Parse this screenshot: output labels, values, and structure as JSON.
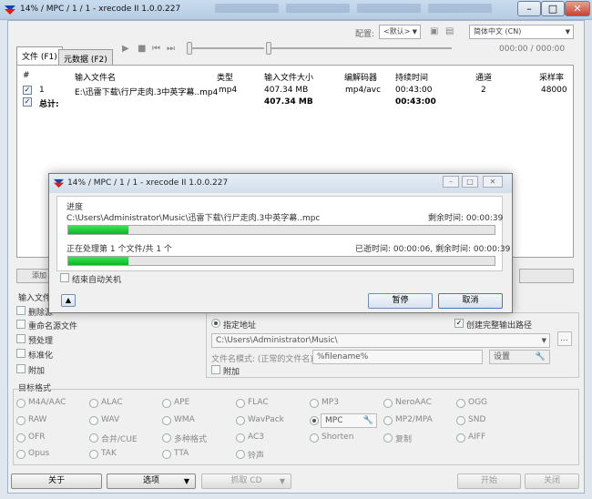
{
  "window": {
    "title": "14% / MPC / 1 / 1 - xrecode II 1.0.0.227"
  },
  "toolbar": {
    "config_label": "配置:",
    "preset_value": "<默认>",
    "language_value": "简体中文 (CN)",
    "time_display": "000:00 / 000:00"
  },
  "tabs": {
    "files": "文件 (F1)",
    "metadata": "元数据 (F2)"
  },
  "filelist": {
    "headers": [
      "#",
      "输入文件名",
      "类型",
      "输入文件大小",
      "编解码器",
      "持续时间",
      "通道",
      "采样率"
    ],
    "row": {
      "index": "1",
      "name": "E:\\迅雷下载\\行尸走肉.3中英字幕..mp4",
      "type": "mp4",
      "size": "407.34 MB",
      "codec": "mp4/avc",
      "duration": "00:43:00",
      "channels": "2",
      "samplerate": "48000"
    },
    "total": {
      "label": "总计:",
      "size": "407.34 MB",
      "duration": "00:43:00"
    }
  },
  "strip": {
    "add_label": "添加"
  },
  "input_options": {
    "title": "输入文件",
    "delete_label": "删除源",
    "rename_label": "重命名源文件",
    "preprocess_label": "预处理",
    "normalize_label": "标准化",
    "append_label": "附加"
  },
  "output": {
    "specify_label": "指定地址",
    "create_tree_label": "创建完整输出路径",
    "path_value": "C:\\Users\\Administrator\\Music\\",
    "pattern_label": "文件名模式: (正常的文件名)",
    "pattern_value": "%filename%",
    "settings_label": "设置",
    "append_label": "附加",
    "browse_label": "..."
  },
  "formats": {
    "title": "目标格式",
    "items": [
      "M4A/AAC",
      "ALAC",
      "APE",
      "FLAC",
      "MP3",
      "NeroAAC",
      "OGG",
      "RAW",
      "WAV",
      "WMA",
      "WavPack",
      "MPC",
      "MP2/MPA",
      "SND",
      "OFR",
      "合并/CUE",
      "多种格式",
      "AC3",
      "Shorten",
      "复制",
      "AIFF",
      "Opus",
      "TAK",
      "TTA",
      "铃声"
    ],
    "selected": "MPC"
  },
  "bottom": {
    "about": "关于",
    "options": "选项",
    "grab_cd": "抓取 CD",
    "start": "开始",
    "close": "关闭"
  },
  "dialog": {
    "title": "14% / MPC / 1 / 1 - xrecode II 1.0.0.227",
    "progress_label": "进度",
    "current_file": "C:\\Users\\Administrator\\Music\\迅雷下载\\行尸走肉.3中英字幕..mpc",
    "remaining_1": "剩余时间: 00:00:39",
    "processing": "正在处理第 1 个文件/共 1 个",
    "elapsed_remaining": "已逝时间: 00:00:06, 剩余时间: 00:00:39",
    "progress1_percent": 14,
    "progress2_percent": 14,
    "shutdown_label": "结束自动关机",
    "pause_label": "暂停",
    "cancel_label": "取消"
  }
}
